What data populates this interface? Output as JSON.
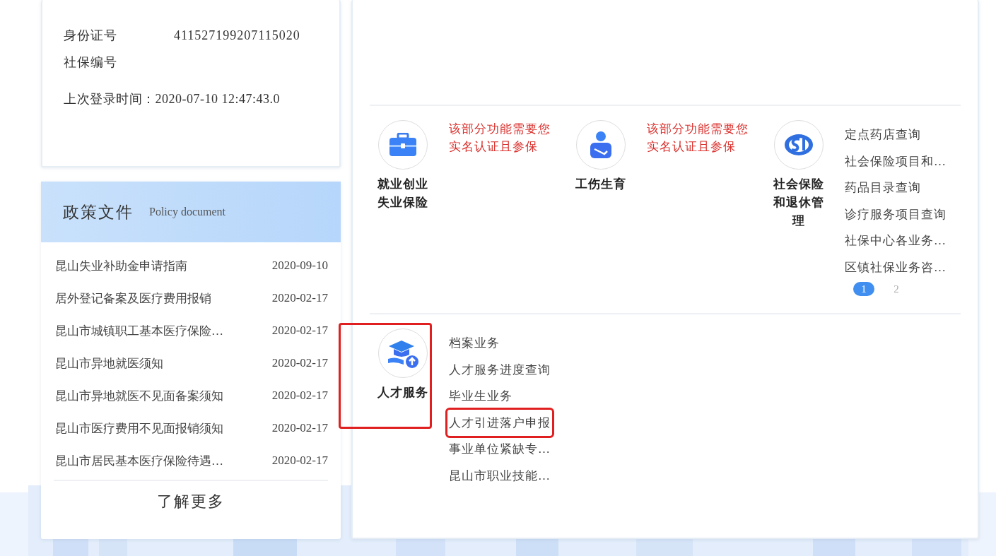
{
  "user_card": {
    "fields": [
      {
        "label": "身份证号",
        "value": "411527199207115020"
      },
      {
        "label": "社保编号"
      }
    ],
    "last_login": "上次登录时间：2020-07-10 12:47:43.0"
  },
  "policy": {
    "title": "政策文件",
    "subtitle": "Policy document",
    "items": [
      {
        "title": "昆山失业补助金申请指南",
        "date": "2020-09-10"
      },
      {
        "title": "居外登记备案及医疗费用报销",
        "date": "2020-02-17"
      },
      {
        "title": "昆山市城镇职工基本医疗保险…",
        "date": "2020-02-17"
      },
      {
        "title": "昆山市异地就医须知",
        "date": "2020-02-17"
      },
      {
        "title": "昆山市异地就医不见面备案须知",
        "date": "2020-02-17"
      },
      {
        "title": "昆山市医疗费用不见面报销须知",
        "date": "2020-02-17"
      },
      {
        "title": "昆山市居民基本医疗保险待遇…",
        "date": "2020-02-17"
      }
    ],
    "more": "了解更多"
  },
  "service_rows": [
    {
      "services": [
        {
          "kind": "briefcase",
          "name": "就业创业失业保险",
          "highlighted": false,
          "notice": "该部分功能需要您实名认证且参保"
        },
        {
          "kind": "injury",
          "name": "工伤生育",
          "highlighted": false,
          "notice": "该部分功能需要您实名认证且参保"
        },
        {
          "kind": "si",
          "name": "社会保险和退休管理",
          "highlighted": false,
          "links": [
            {
              "label": "定点药店查询",
              "highlighted": false
            },
            {
              "label": "社会保险项目和…",
              "highlighted": false
            },
            {
              "label": "药品目录查询",
              "highlighted": false
            },
            {
              "label": "诊疗服务项目查询",
              "highlighted": false
            },
            {
              "label": "社保中心各业务…",
              "highlighted": false
            },
            {
              "label": "区镇社保业务咨…",
              "highlighted": false
            }
          ],
          "pages": [
            {
              "label": "1",
              "selected": true
            },
            {
              "label": "2",
              "selected": false
            }
          ]
        }
      ]
    },
    {
      "services": [
        {
          "kind": "graduate",
          "name": "人才服务",
          "highlighted": true,
          "links": [
            {
              "label": "档案业务",
              "highlighted": false
            },
            {
              "label": "人才服务进度查询",
              "highlighted": false
            },
            {
              "label": "毕业生业务",
              "highlighted": false
            },
            {
              "label": "人才引进落户申报",
              "highlighted": true
            },
            {
              "label": "事业单位紧缺专…",
              "highlighted": false
            },
            {
              "label": "昆山市职业技能…",
              "highlighted": false
            }
          ]
        }
      ]
    }
  ]
}
